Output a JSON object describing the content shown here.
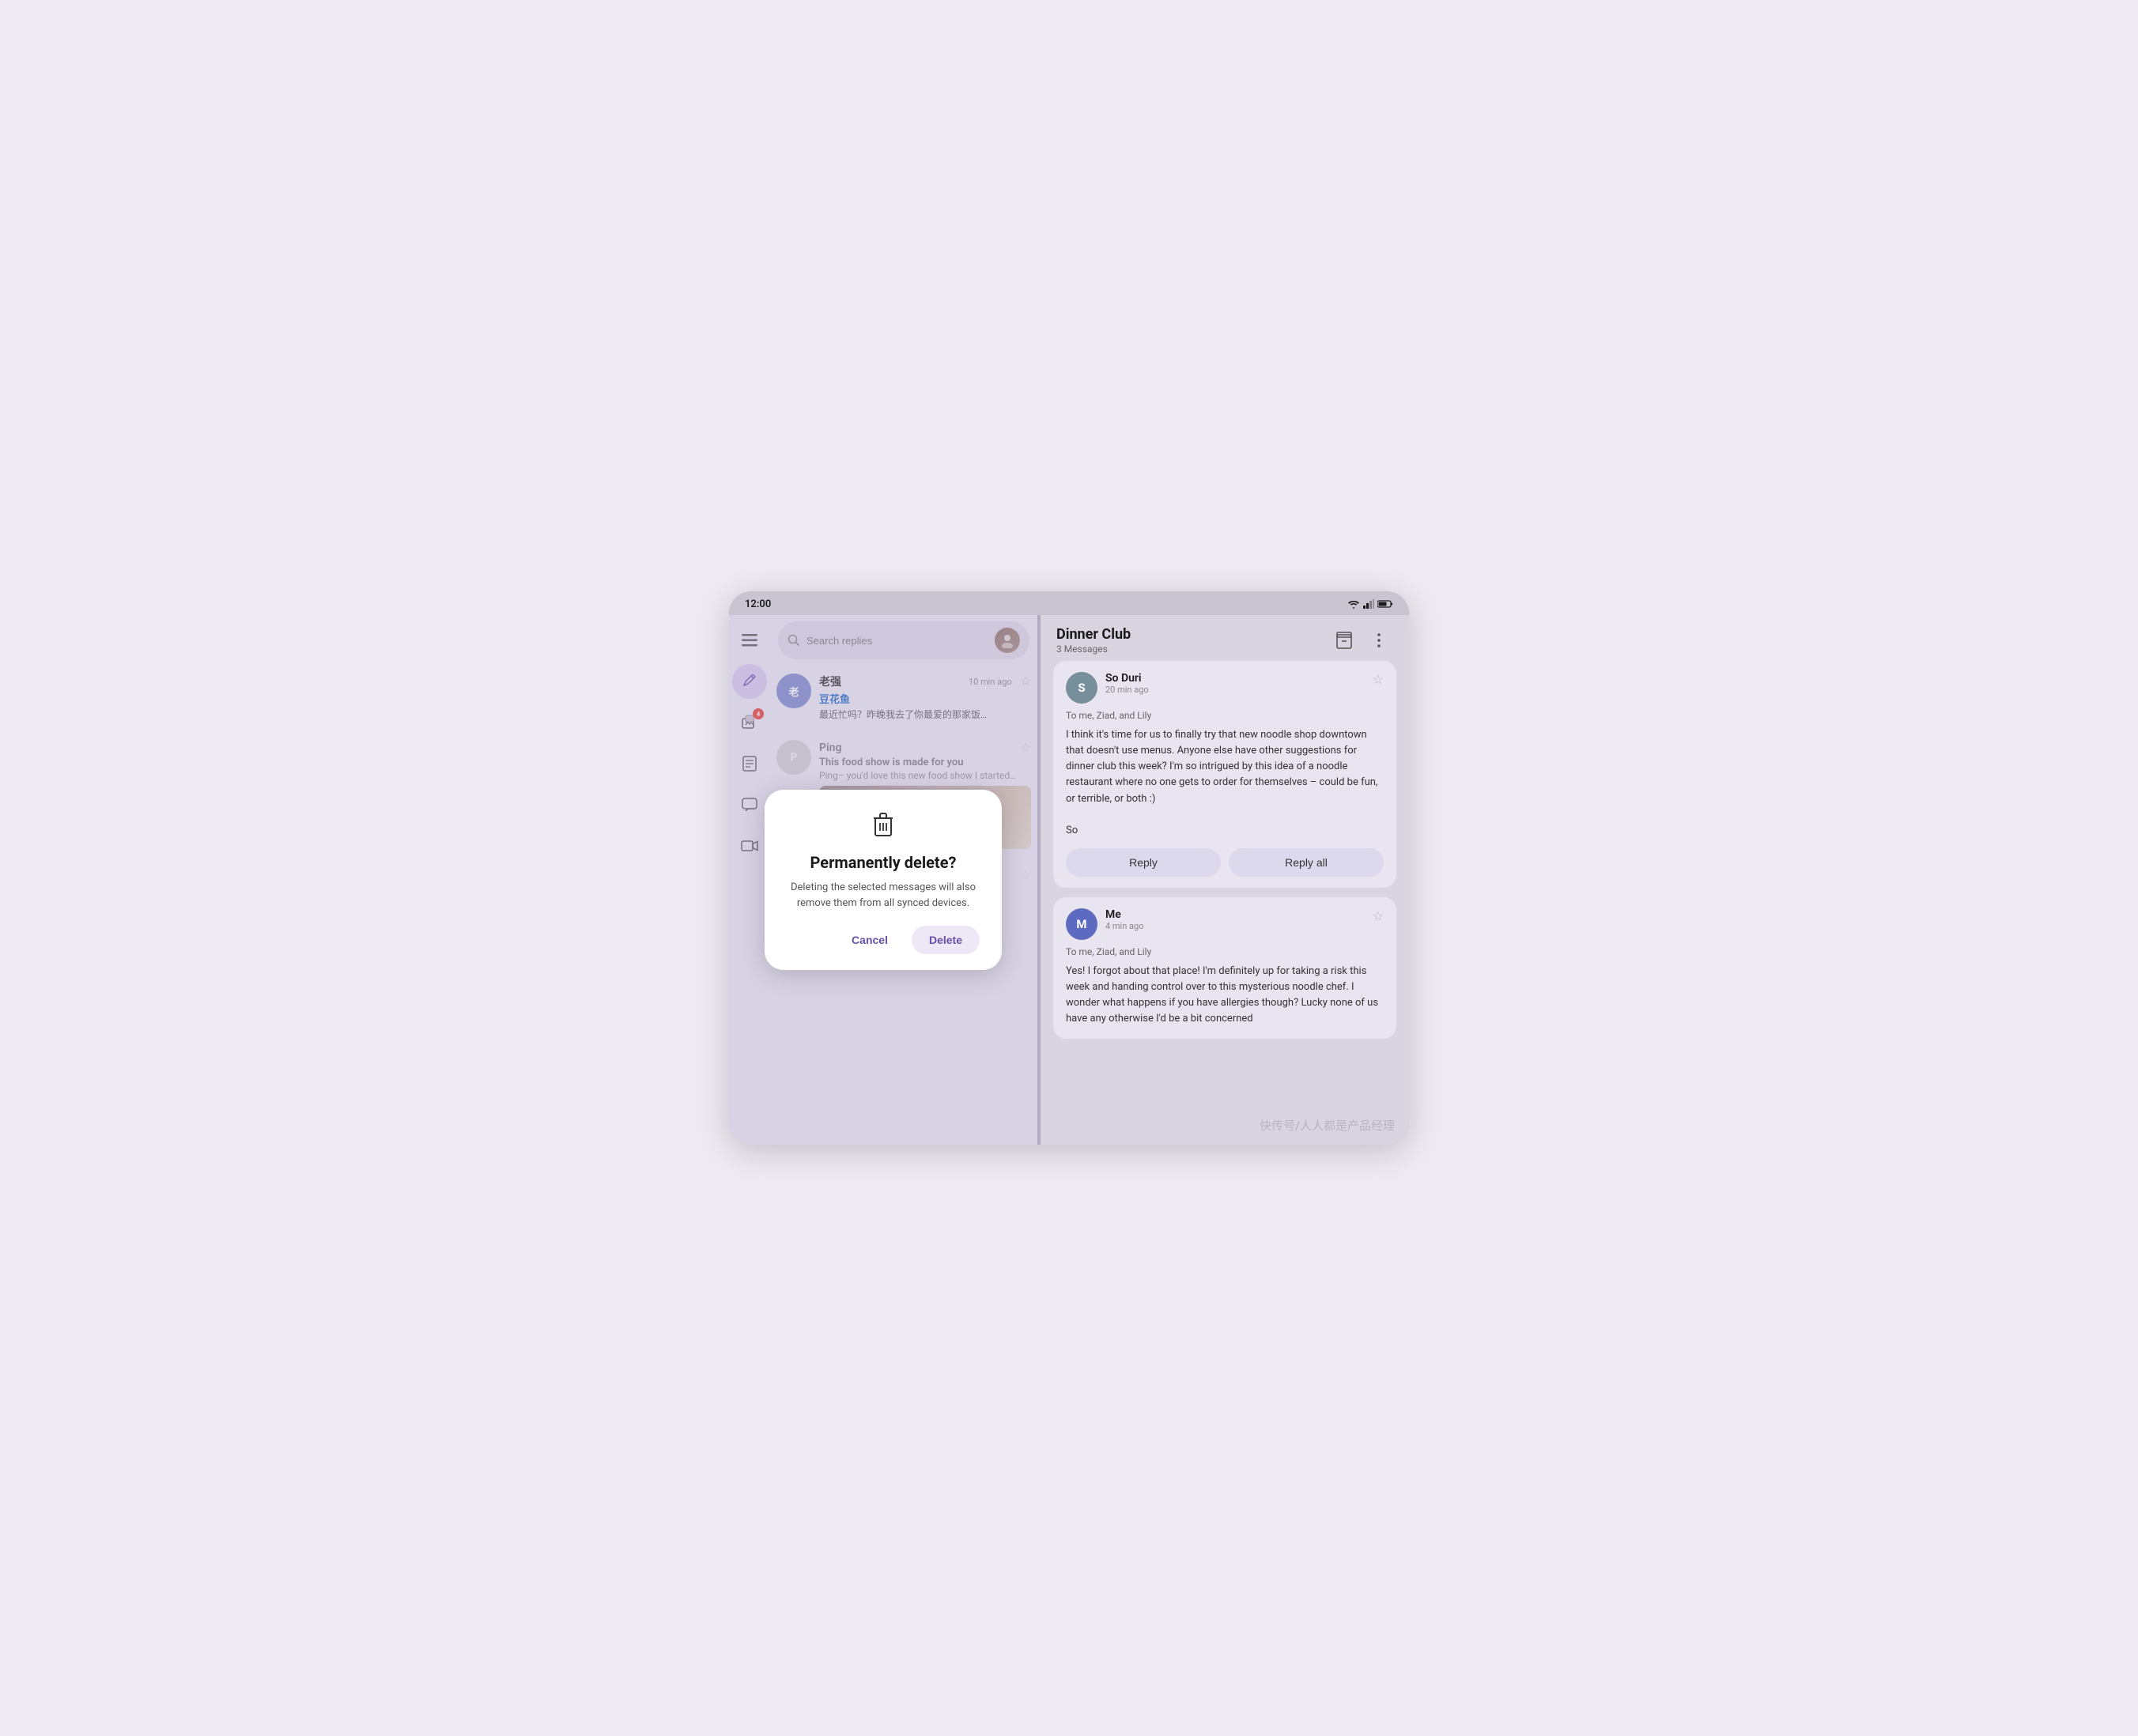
{
  "device": {
    "time": "12:00",
    "status_icons": [
      "wifi",
      "signal",
      "battery"
    ]
  },
  "sidebar": {
    "items": [
      {
        "icon": "☰",
        "label": "menu",
        "active": false
      },
      {
        "icon": "✏",
        "label": "compose",
        "active": true,
        "badge": null
      },
      {
        "icon": "📷",
        "label": "photos",
        "active": false,
        "badge": "4"
      },
      {
        "icon": "📄",
        "label": "docs",
        "active": false
      },
      {
        "icon": "💬",
        "label": "chat",
        "active": false
      },
      {
        "icon": "🎥",
        "label": "video",
        "active": false
      }
    ]
  },
  "search": {
    "placeholder": "Search replies"
  },
  "messages": [
    {
      "id": 1,
      "sender": "老强",
      "time": "10 min ago",
      "subject": "豆花鱼",
      "preview": "最近忙吗？昨晚我去了你最爱的那家饭馆，点了",
      "avatar_color": "#7986cb",
      "avatar_text": "老"
    },
    {
      "id": 2,
      "sender": "Ping",
      "time": "",
      "subject": "This food show is made for you",
      "preview": "Ping– you'd love this new food show I started watching. It's produced by a Thai drummer...",
      "avatar_color": "#aaa",
      "avatar_text": "P",
      "has_image": true
    }
  ],
  "email_thread": {
    "title": "Dinner Club",
    "message_count": "3 Messages",
    "messages": [
      {
        "sender": "So Duri",
        "time": "20 min ago",
        "to": "To me, Ziad, and Lily",
        "body": "I think it's time for us to finally try that new noodle shop downtown that doesn't use menus. Anyone else have other suggestions for dinner club this week? I'm so intrigued by this idea of a noodle restaurant where no one gets to order for themselves – could be fun, or terrible, or both :)\n\nSo",
        "avatar_color": "#78909c",
        "avatar_text": "S",
        "actions": [
          "Reply",
          "Reply all"
        ]
      },
      {
        "sender": "Me",
        "time": "4 min ago",
        "to": "To me, Ziad, and Lily",
        "body": "Yes! I forgot about that place! I'm definitely up for taking a risk this week and handing control over to this mysterious noodle chef. I wonder what happens if you have allergies though? Lucky none of us have any otherwise I'd be a bit concerned",
        "avatar_color": "#5c6bc0",
        "avatar_text": "M"
      }
    ]
  },
  "dialog": {
    "icon": "🗑",
    "title": "Permanently delete?",
    "body": "Deleting the selected messages will also remove them from all synced devices.",
    "cancel_label": "Cancel",
    "delete_label": "Delete"
  },
  "watermark": "快传号/人人都是产品经理"
}
